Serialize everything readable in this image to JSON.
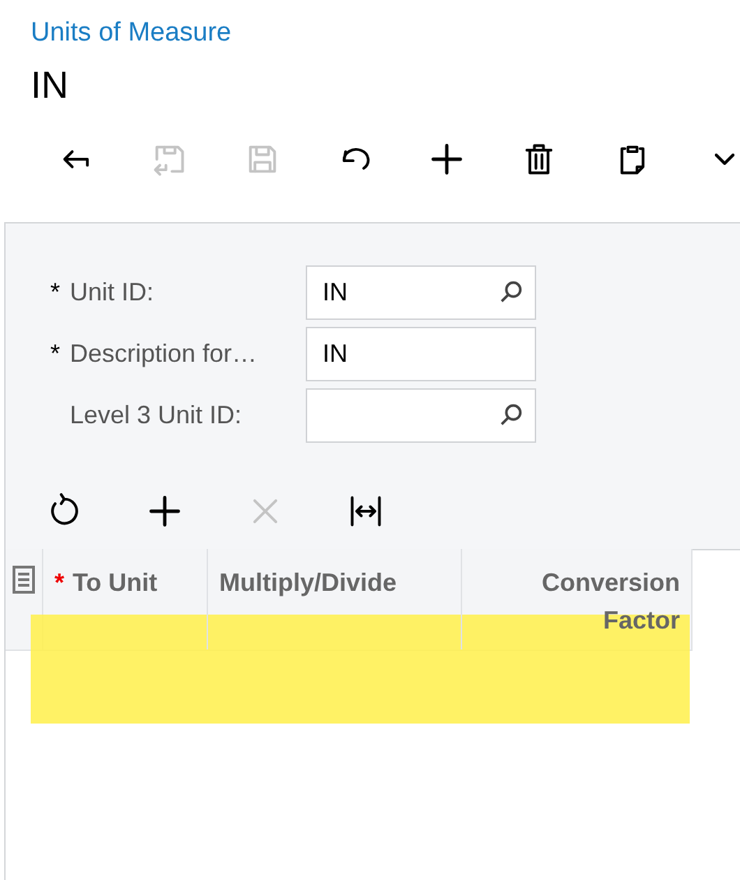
{
  "breadcrumb": "Units of Measure",
  "title": "IN",
  "toolbar": [
    {
      "kind": "back",
      "disabled": false
    },
    {
      "kind": "save-close",
      "disabled": true
    },
    {
      "kind": "save",
      "disabled": true
    },
    {
      "kind": "undo",
      "disabled": false
    },
    {
      "kind": "add",
      "disabled": false
    },
    {
      "kind": "delete",
      "disabled": false
    },
    {
      "kind": "copy",
      "disabled": false
    },
    {
      "kind": "more",
      "disabled": false
    }
  ],
  "form": {
    "fields": [
      {
        "required_mark": "*",
        "label": "Unit ID:",
        "value": "IN",
        "lookup": true
      },
      {
        "required_mark": "*",
        "label": "Description for…",
        "value": "IN",
        "lookup": false
      },
      {
        "label": "Level 3 Unit ID:",
        "lookup": true
      }
    ]
  },
  "grid": {
    "toolbar": [
      {
        "kind": "refresh",
        "disabled": false
      },
      {
        "kind": "add",
        "disabled": false
      },
      {
        "kind": "remove",
        "disabled": true
      },
      {
        "kind": "fit",
        "disabled": false
      }
    ],
    "columns": [
      {
        "required_mark": "*",
        "label": "To Unit",
        "right_aligned": false
      },
      {
        "label": "Multiply/Divide",
        "right_aligned": false
      },
      {
        "label": "Conversion Factor",
        "right_aligned": true
      }
    ]
  }
}
